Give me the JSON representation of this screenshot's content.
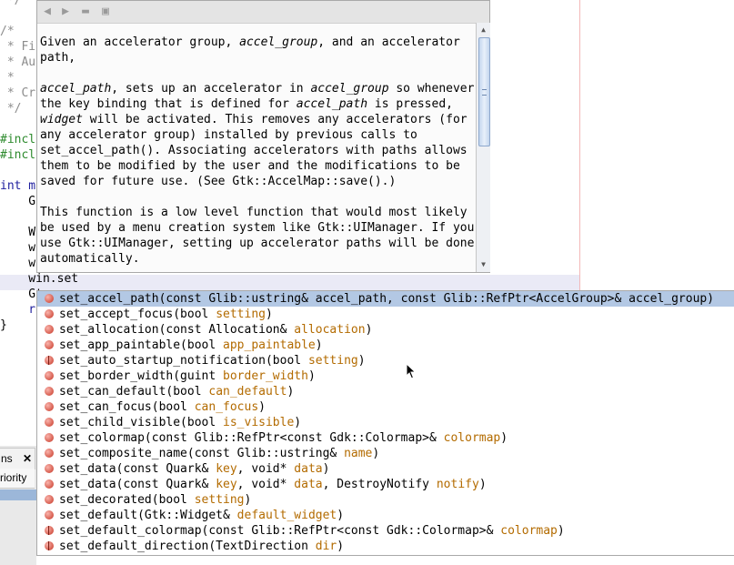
{
  "editor": {
    "lines": [
      {
        "text": " */",
        "cls": "c-comment"
      },
      {
        "text": "",
        "cls": ""
      },
      {
        "text": "/*",
        "cls": "c-comment"
      },
      {
        "text": " * Fi",
        "cls": "c-comment"
      },
      {
        "text": " * Aut",
        "cls": "c-comment"
      },
      {
        "text": " *",
        "cls": "c-comment"
      },
      {
        "text": " * Cre",
        "cls": "c-comment"
      },
      {
        "text": " */",
        "cls": "c-comment"
      },
      {
        "text": "",
        "cls": ""
      },
      {
        "text": "#incl",
        "cls": "c-pre"
      },
      {
        "text": "#incl",
        "cls": "c-pre"
      },
      {
        "text": "",
        "cls": ""
      },
      {
        "text": "int ma",
        "cls": "c-kw"
      },
      {
        "text": "    Gt",
        "cls": ""
      },
      {
        "text": "",
        "cls": ""
      },
      {
        "text": "    Wi",
        "cls": ""
      },
      {
        "text": "    wi",
        "cls": ""
      },
      {
        "text": "    wi",
        "cls": ""
      },
      {
        "text": "    win.set",
        "cls": ""
      },
      {
        "text": "    Gt",
        "cls": ""
      },
      {
        "text": "    re",
        "cls": "c-kw"
      },
      {
        "text": "}",
        "cls": ""
      }
    ]
  },
  "panel": {
    "tab_label": "ns",
    "tab_close": "✕",
    "header_label": "riority"
  },
  "doc": {
    "toolbar_icons": [
      "back-icon",
      "forward-icon",
      "open-icon",
      "copy-icon"
    ],
    "para1": {
      "t1": "Given an accelerator group, ",
      "i1": "accel_group",
      "t2": ", and an accelerator path,"
    },
    "para2": {
      "i1": "accel_path",
      "t1": ", sets up an accelerator in ",
      "i2": "accel_group",
      "t2": " so whenever the key binding that is defined for ",
      "i3": "accel_path",
      "t3": " is pressed, ",
      "i4": "widget",
      "t4": " will be activated. This removes any accelerators (for any accelerator group) installed by previous calls to set_accel_path(). Associating accelerators with paths allows them to be modified by the user and the modifications to be saved for future use. (See Gtk::AccelMap::save().)"
    },
    "para3": "This function is a low level function that would most likely be used by a menu creation system like Gtk::UIManager. If you use Gtk::UIManager, setting up accelerator paths will be done automatically."
  },
  "completion": {
    "items": [
      {
        "pre": "set_accel_path(const Glib::ustring& accel_path, const Glib::RefPtr<AccelGroup>& accel_group)",
        "param": "",
        "post": "",
        "half": false,
        "selected": true
      },
      {
        "pre": "set_accept_focus(bool ",
        "param": "setting",
        "post": ")",
        "half": false
      },
      {
        "pre": "set_allocation(const Allocation& ",
        "param": "allocation",
        "post": ")",
        "half": false
      },
      {
        "pre": "set_app_paintable(bool ",
        "param": "app_paintable",
        "post": ")",
        "half": false
      },
      {
        "pre": "set_auto_startup_notification(bool ",
        "param": "setting",
        "post": ")",
        "half": true
      },
      {
        "pre": "set_border_width(guint ",
        "param": "border_width",
        "post": ")",
        "half": false
      },
      {
        "pre": "set_can_default(bool ",
        "param": "can_default",
        "post": ")",
        "half": false
      },
      {
        "pre": "set_can_focus(bool ",
        "param": "can_focus",
        "post": ")",
        "half": false
      },
      {
        "pre": "set_child_visible(bool ",
        "param": "is_visible",
        "post": ")",
        "half": false
      },
      {
        "pre": "set_colormap(const Glib::RefPtr<const Gdk::Colormap>& ",
        "param": "colormap",
        "post": ")",
        "half": false
      },
      {
        "pre": "set_composite_name(const Glib::ustring& ",
        "param": "name",
        "post": ")",
        "half": false
      },
      {
        "pre": "set_data(const Quark& ",
        "param": "key",
        "post": ", void* ",
        "param2": "data",
        "post2": ")",
        "half": false
      },
      {
        "pre": "set_data(const Quark& ",
        "param": "key",
        "post": ", void* ",
        "param2": "data",
        "post2": ", DestroyNotify ",
        "param3": "notify",
        "post3": ")",
        "half": false
      },
      {
        "pre": "set_decorated(bool ",
        "param": "setting",
        "post": ")",
        "half": false
      },
      {
        "pre": "set_default(Gtk::Widget& ",
        "param": "default_widget",
        "post": ")",
        "half": false
      },
      {
        "pre": "set_default_colormap(const Glib::RefPtr<const Gdk::Colormap>& ",
        "param": "colormap",
        "post": ")",
        "half": true
      },
      {
        "pre": "set_default_direction(TextDirection ",
        "param": "dir",
        "post": ")",
        "half": true
      }
    ]
  }
}
